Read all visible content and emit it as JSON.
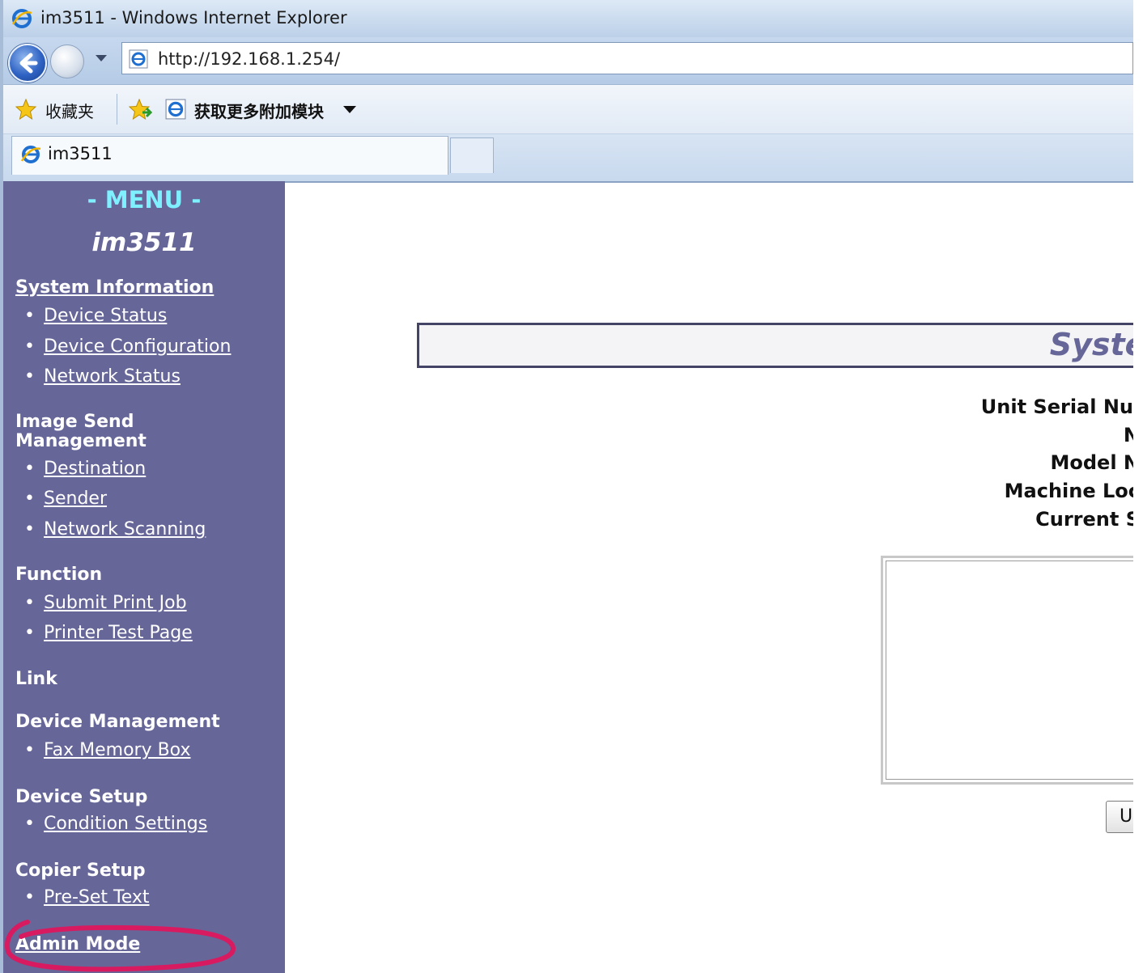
{
  "window": {
    "title": "im3511 - Windows Internet Explorer"
  },
  "address_bar": {
    "url": "http://192.168.1.254/"
  },
  "favorites_bar": {
    "favorites_label": "收藏夹",
    "addons_label": "获取更多附加模块"
  },
  "tabs": [
    {
      "label": "im3511"
    }
  ],
  "sidebar": {
    "menu_title": "- MENU -",
    "host_name": "im3511",
    "sections": [
      {
        "title": "System Information",
        "items": [
          "Device Status",
          "Device Configuration",
          "Network Status"
        ]
      },
      {
        "title": "Image Send Management",
        "items": [
          "Destination",
          "Sender",
          "Network Scanning"
        ]
      },
      {
        "title": "Function",
        "items": [
          "Submit Print Job",
          "Printer Test Page"
        ]
      },
      {
        "title": "Link",
        "items": []
      },
      {
        "title": "Device Management",
        "items": [
          "Fax Memory Box"
        ]
      },
      {
        "title": "Device Setup",
        "items": [
          "Condition Settings"
        ]
      },
      {
        "title": "Copier Setup",
        "items": [
          "Pre-Set Text"
        ]
      },
      {
        "title": "Admin Mode",
        "items": []
      }
    ]
  },
  "main": {
    "header_title": "System",
    "info_labels": [
      "Unit Serial Nu",
      "N",
      "Model N",
      "Machine Loc",
      "Current S"
    ],
    "update_button": "U"
  },
  "colors": {
    "sidebar_bg": "#666699",
    "menu_title": "#7ff0ff",
    "highlight_circle": "#d81b60"
  }
}
